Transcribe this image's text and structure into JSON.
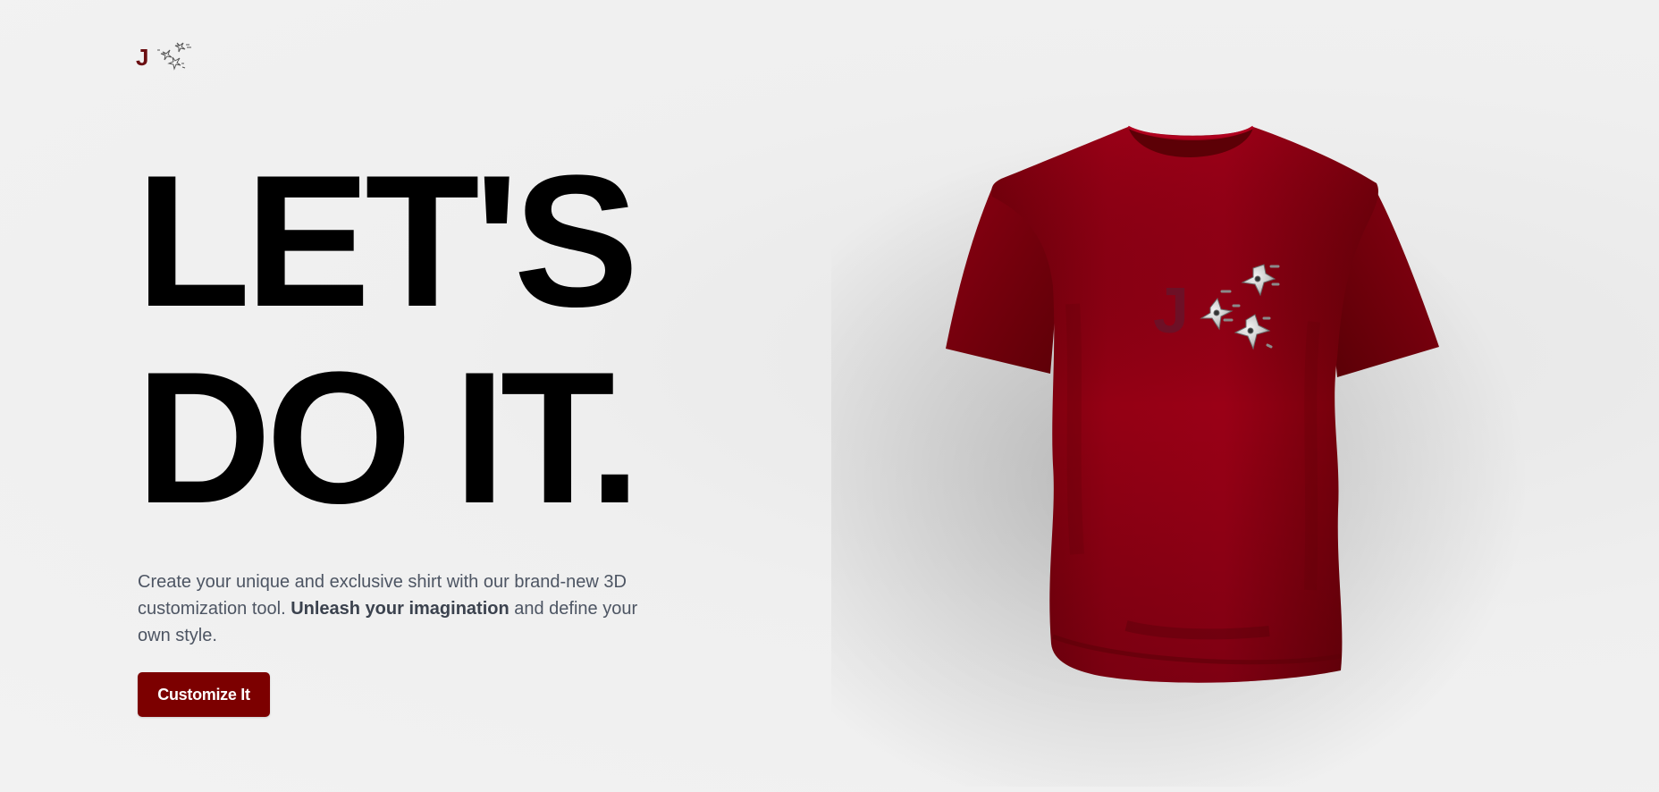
{
  "brand": {
    "letter": "J",
    "icon": "shuriken-icon"
  },
  "hero": {
    "headline_line1": "LET'S",
    "headline_line2": "DO IT.",
    "description_part1": "Create your unique and exclusive shirt with our brand-new 3D customization tool.",
    "description_bold": "Unleash your imagination",
    "description_part2": "and define your own style.",
    "cta_label": "Customize It"
  },
  "shirt": {
    "color": "#8b0012",
    "decal_letter": "J",
    "decal_icon": "shuriken-icon"
  },
  "colors": {
    "accent": "#7c0000",
    "background": "#f0f0f0",
    "text_muted": "#4d5563"
  }
}
